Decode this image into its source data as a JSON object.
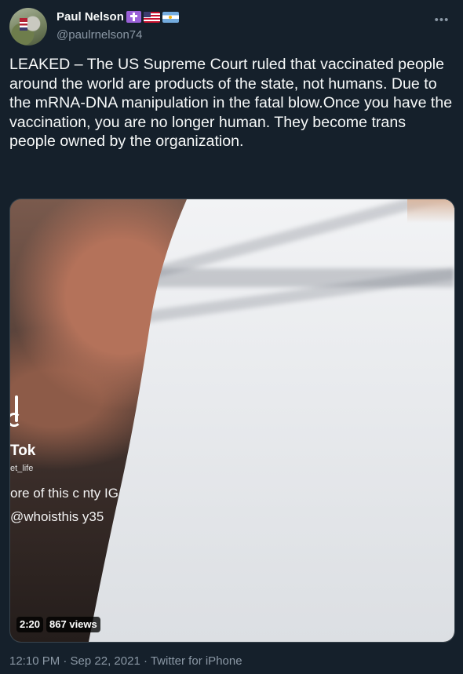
{
  "tweet": {
    "author": {
      "name": "Paul Nelson",
      "handle": "@paulrnelson74",
      "name_emojis": [
        "latin-cross-emoji",
        "us-flag-emoji",
        "argentina-flag-emoji"
      ]
    },
    "text": "LEAKED – The US Supreme Court ruled that vaccinated people around the world are products of the state, not humans. Due to the mRNA-DNA manipulation in the fatal blow.Once you have the vaccination, you are no longer human. They become trans people owned by the organization.",
    "more_icon": "more-horizontal-icon",
    "media": {
      "type": "video",
      "duration": "2:20",
      "views": "867 views",
      "overlay": {
        "app": "Tok",
        "username": "et_life",
        "line1": "ore of this c  nty IG",
        "line2": "@whoisthis     y35"
      }
    },
    "footer": "12:10 PM · Sep 22, 2021 · Twitter for iPhone"
  },
  "colors": {
    "background": "#15202b",
    "text": "#f7f9f9",
    "secondary": "#8b98a5",
    "border": "#38444d"
  }
}
